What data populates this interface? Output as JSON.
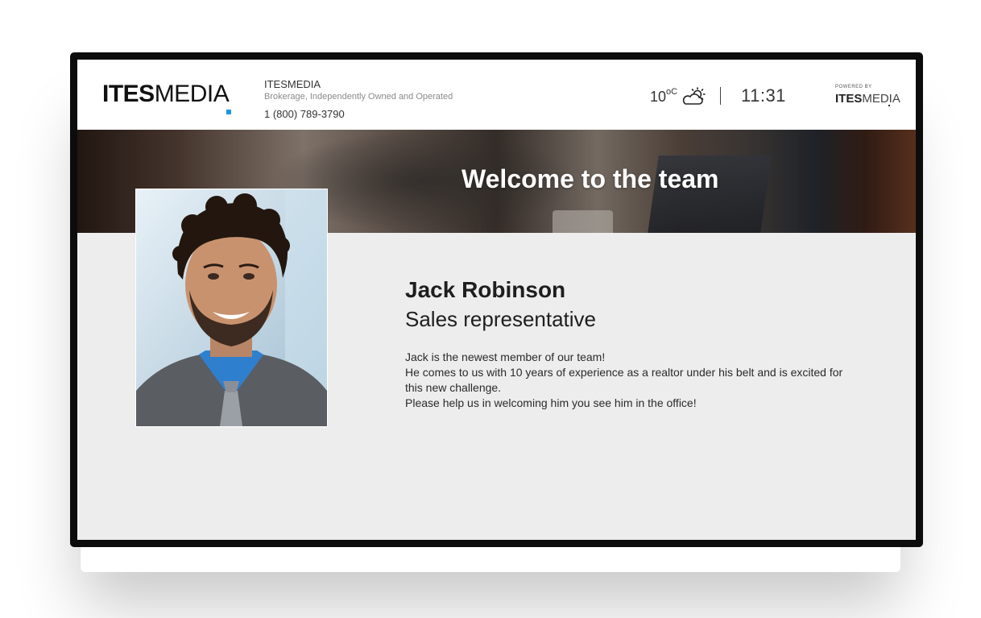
{
  "header": {
    "logo_bold": "ITES",
    "logo_light": "MEDIA",
    "company_name": "ITESMEDIA",
    "tagline": "Brokerage, Independently Owned and Operated",
    "phone": "1 (800) 789-3790",
    "temperature": "10",
    "temperature_unit": "oC",
    "weather_icon": "partly-cloudy-icon",
    "time": "11:31",
    "powered_by_label": "POWERED BY",
    "powered_brand_bold": "ITES",
    "powered_brand_light": "MEDIA"
  },
  "banner": {
    "title": "Welcome to the team"
  },
  "employee": {
    "name": "Jack Robinson",
    "role": "Sales representative",
    "bio": [
      "Jack is the newest member of our team!",
      "He comes to us with 10 years of experience as a realtor under his belt and is excited for this new challenge.",
      "Please help us in welcoming him you see him in the office!"
    ]
  },
  "colors": {
    "accent": "#1e9ad6",
    "screen_background": "#ededed",
    "monitor_frame": "#0c0c0c"
  }
}
